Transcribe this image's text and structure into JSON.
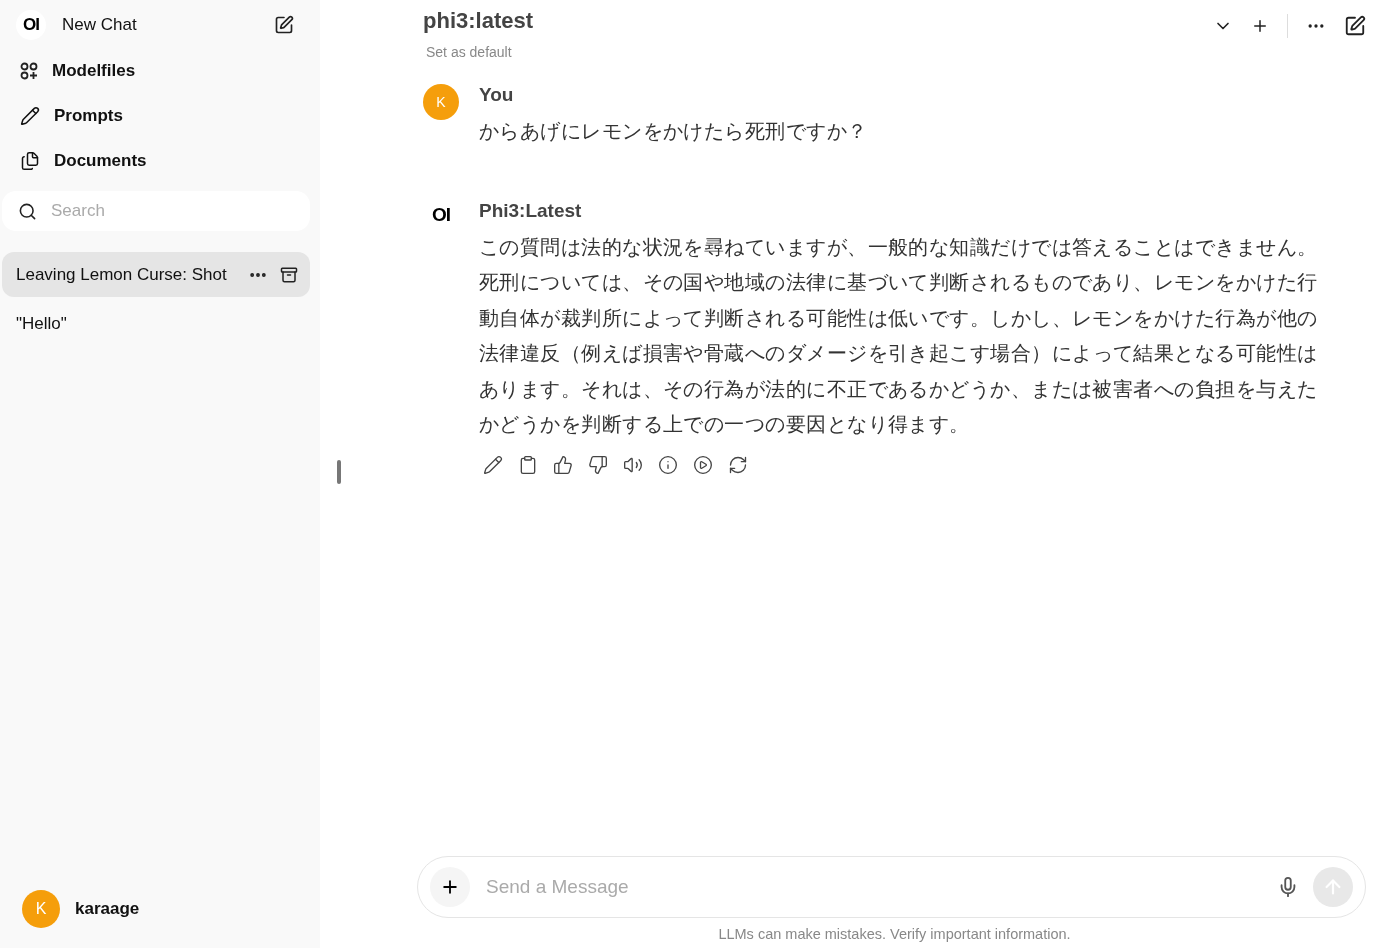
{
  "sidebar": {
    "logo": "OI",
    "new_chat": "New Chat",
    "nav": [
      {
        "label": "Modelfiles"
      },
      {
        "label": "Prompts"
      },
      {
        "label": "Documents"
      }
    ],
    "search": {
      "placeholder": "Search"
    },
    "chats": [
      {
        "title": "Leaving Lemon Curse: Shot",
        "selected": true
      },
      {
        "title": "\"Hello\"",
        "selected": false
      }
    ],
    "user": {
      "avatar": "K",
      "name": "karaage"
    }
  },
  "header": {
    "model": "phi3:latest",
    "set_default": "Set as default"
  },
  "messages": [
    {
      "kind": "user",
      "avatar": "K",
      "author": "You",
      "text": "からあげにレモンをかけたら死刑ですか？"
    },
    {
      "kind": "assistant",
      "avatar": "OI",
      "author": "Phi3:Latest",
      "text": "この質問は法的な状況を尋ねていますが、一般的な知識だけでは答えることはできません。死刑については、その国や地域の法律に基づいて判断されるものであり、レモンをかけた行動自体が裁判所によって判断される可能性は低いです。しかし、レモンをかけた行為が他の法律違反（例えば損害や骨蔵へのダメージを引き起こす場合）によって結果となる可能性はあります。それは、その行為が法的に不正であるかどうか、または被害者への負担を与えたかどうかを判断する上での一つの要因となり得ます。"
    }
  ],
  "composer": {
    "placeholder": "Send a Message"
  },
  "disclaimer": "LLMs can make mistakes. Verify important information."
}
